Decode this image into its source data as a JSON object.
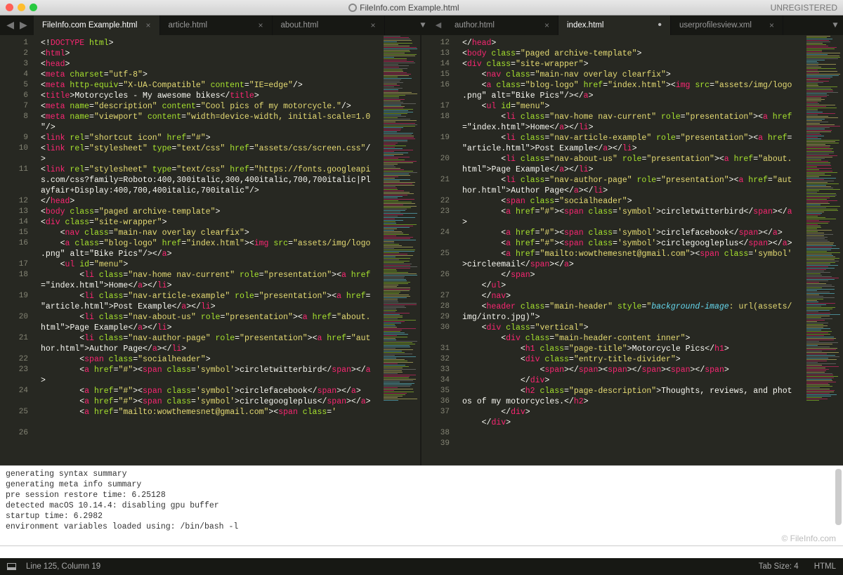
{
  "title": "FileInfo.com Example.html",
  "registration": "UNREGISTERED",
  "nav_back": "◀",
  "nav_fwd": "▶",
  "tabs_left": [
    {
      "label": "FileInfo.com Example.html",
      "active": true,
      "mod": false
    },
    {
      "label": "article.html",
      "active": false,
      "mod": false
    },
    {
      "label": "about.html",
      "active": false,
      "mod": false
    }
  ],
  "tabs_right": [
    {
      "label": "author.html",
      "active": false,
      "mod": false
    },
    {
      "label": "index.html",
      "active": true,
      "mod": true
    },
    {
      "label": "userprofilesview.xml",
      "active": false,
      "mod": false
    }
  ],
  "chev_down": "▼",
  "left_start": 1,
  "left_lines": [
    "<!DOCTYPE html>",
    "<html>",
    "<head>",
    "<meta charset=\"utf-8\">",
    "<meta http-equiv=\"X-UA-Compatible\" content=\"IE=edge\"/>",
    "<title>Motorcycles - My awesome bikes</title>",
    "<meta name=\"description\" content=\"Cool pics of my motorcycle.\"/>",
    "<meta name=\"viewport\" content=\"width=device-width, initial-scale=1.0\"/>",
    "<link rel=\"shortcut icon\" href=\"#\">",
    "<link rel=\"stylesheet\" type=\"text/css\" href=\"assets/css/screen.css\"/>",
    "<link rel=\"stylesheet\" type=\"text/css\" href=\"https://fonts.googleapis.com/css?family=Roboto:400,300italic,300,400italic,700,700italic|Playfair+Display:400,700,400italic,700italic\"/>",
    "</head>",
    "<body class=\"paged archive-template\">",
    "<div class=\"site-wrapper\">",
    "    <nav class=\"main-nav overlay clearfix\">",
    "    <a class=\"blog-logo\" href=\"index.html\"><img src=\"assets/img/logo.png\" alt=\"Bike Pics\"/></a>",
    "    <ul id=\"menu\">",
    "        <li class=\"nav-home nav-current\" role=\"presentation\"><a href=\"index.html\">Home</a></li>",
    "        <li class=\"nav-article-example\" role=\"presentation\"><a href=\"article.html\">Post Example</a></li>",
    "        <li class=\"nav-about-us\" role=\"presentation\"><a href=\"about.html\">Page Example</a></li>",
    "        <li class=\"nav-author-page\" role=\"presentation\"><a href=\"author.html\">Author Page</a></li>",
    "        <span class=\"socialheader\">",
    "        <a href=\"#\"><span class='symbol'>circletwitterbird</span></a>",
    "        <a href=\"#\"><span class='symbol'>circlefacebook</span></a>",
    "        <a href=\"#\"><span class='symbol'>circlegoogleplus</span></a>",
    "        <a href=\"mailto:wowthemesnet@gmail.com\"><span class='"
  ],
  "left_gutter": [
    "1",
    "2",
    "3",
    "4",
    "5",
    "6",
    "7",
    "8",
    "",
    "9",
    "10",
    "",
    "11",
    "",
    "",
    "12",
    "13",
    "14",
    "15",
    "16",
    "",
    "17",
    "18",
    "",
    "19",
    "",
    "20",
    "",
    "21",
    "",
    "22",
    "23",
    "",
    "24",
    "",
    "25",
    "",
    "26"
  ],
  "left_marks": [
    6,
    16
  ],
  "right_start": 12,
  "right_lines": [
    "</head>",
    "<body class=\"paged archive-template\">",
    "<div class=\"site-wrapper\">",
    "    <nav class=\"main-nav overlay clearfix\">",
    "    <a class=\"blog-logo\" href=\"index.html\"><img src=\"assets/img/logo.png\" alt=\"Bike Pics\"/></a>",
    "    <ul id=\"menu\">",
    "        <li class=\"nav-home nav-current\" role=\"presentation\"><a href=\"index.html\">Home</a></li>",
    "        <li class=\"nav-article-example\" role=\"presentation\"><a href=\"article.html\">Post Example</a></li>",
    "        <li class=\"nav-about-us\" role=\"presentation\"><a href=\"about.html\">Page Example</a></li>",
    "        <li class=\"nav-author-page\" role=\"presentation\"><a href=\"author.html\">Author Page</a></li>",
    "        <span class=\"socialheader\">",
    "        <a href=\"#\"><span class='symbol'>circletwitterbird</span></a>",
    "        <a href=\"#\"><span class='symbol'>circlefacebook</span></a>",
    "        <a href=\"#\"><span class='symbol'>circlegoogleplus</span></a>",
    "        <a href=\"mailto:wowthemesnet@gmail.com\"><span class='symbol'>circleemail</span></a>",
    "        </span>",
    "    </ul>",
    "    </nav>",
    "    <header class=\"main-header\" style=\"background-image: url(assets/img/intro.jpg)\">",
    "    <div class=\"vertical\">",
    "        <div class=\"main-header-content inner\">",
    "            <h1 class=\"page-title\">Motorcycle Pics</h1>",
    "            <div class=\"entry-title-divider\">",
    "                <span></span><span></span><span></span>",
    "            </div>",
    "            <h2 class=\"page-description\">Thoughts, reviews, and photos of my motorcycles.</h2>",
    "        </div>",
    "    </div>"
  ],
  "right_gutter": [
    "12",
    "13",
    "14",
    "15",
    "16",
    "",
    "17",
    "18",
    "",
    "19",
    "",
    "20",
    "",
    "21",
    "",
    "22",
    "23",
    "",
    "24",
    "",
    "25",
    "",
    "26",
    "",
    "27",
    "28",
    "29",
    "30",
    "",
    "31",
    "32",
    "33",
    "34",
    "35",
    "36",
    "37",
    "",
    "38",
    "39"
  ],
  "console_lines": [
    "generating syntax summary",
    "generating meta info summary",
    "pre session restore time: 6.25128",
    "detected macOS 10.14.4: disabling gpu buffer",
    "startup time: 6.2982",
    "environment variables loaded using: /bin/bash -l"
  ],
  "watermark": "© FileInfo.com",
  "status": {
    "cursor": "Line 125, Column 19",
    "tabsize": "Tab Size: 4",
    "lang": "HTML"
  }
}
